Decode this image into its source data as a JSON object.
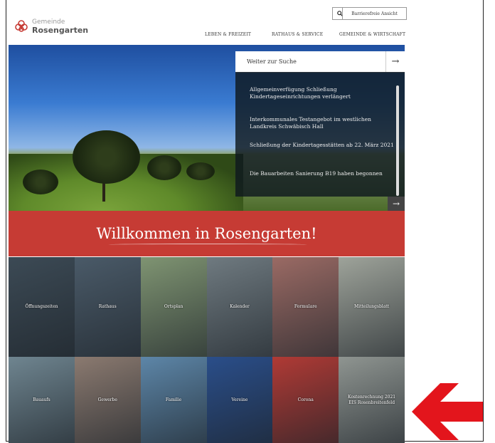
{
  "header": {
    "logo_top": "Gemeinde",
    "logo_bottom": "Rosengarten",
    "accessibility_label": "Barrierefreie Ansicht",
    "brand_color": "#c63b34"
  },
  "nav": {
    "items": [
      "LEBEN & FREIZEIT",
      "RATHAUS & SERVICE",
      "GEMEINDE & WIRTSCHAFT"
    ]
  },
  "search": {
    "label": "Weiter zur Suche",
    "icon": "arrow-right-icon"
  },
  "news": [
    "Allgemeinverfügung Schließung Kindertageseinrichtungen verlängert",
    "Interkommunales Testangebot im westlichen Landkreis Schwäbisch Hall",
    "Schließung der Kindertagesstätten ab 22. März 2021",
    "Die Bauarbeiten Sanierung B19 haben begonnen"
  ],
  "welcome": "Willkommen in Rosengarten!",
  "tiles": [
    {
      "label": "Öffnungszeiten",
      "color": "#3c4a55"
    },
    {
      "label": "Rathaus",
      "color": "#4a5a68"
    },
    {
      "label": "Ortsplan",
      "color": "#7f9472"
    },
    {
      "label": "Kalender",
      "color": "#6f7a80"
    },
    {
      "label": "Formulare",
      "color": "#9a6a64"
    },
    {
      "label": "Mitteilungsblatt",
      "color": "#9ea39a"
    },
    {
      "label": "Bauaufs",
      "color": "#6f8590"
    },
    {
      "label": "Gewerbe",
      "color": "#8b7a70"
    },
    {
      "label": "Familie",
      "color": "#5d86a8"
    },
    {
      "label": "Vereine",
      "color": "#2a4e8a"
    },
    {
      "label": "Corona",
      "color": "#b03a35"
    },
    {
      "label": "Kostenrechnung 2021",
      "label2": "EIS Rosenbreitenfeld",
      "color": "#8f9591"
    }
  ],
  "annotation": {
    "color": "#e3151c",
    "icon": "arrow-left-icon"
  }
}
